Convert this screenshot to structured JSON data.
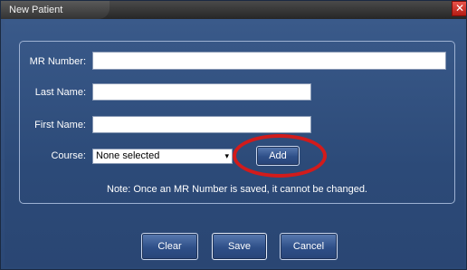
{
  "window": {
    "title": "New Patient",
    "close_symbol": "✕"
  },
  "form": {
    "mr_number": {
      "label": "MR Number:",
      "value": ""
    },
    "last_name": {
      "label": "Last Name:",
      "value": ""
    },
    "first_name": {
      "label": "First Name:",
      "value": ""
    },
    "course": {
      "label": "Course:",
      "selected": "None selected"
    },
    "add_label": "Add",
    "note": "Note: Once an MR Number is saved, it cannot be changed."
  },
  "buttons": {
    "clear": "Clear",
    "save": "Save",
    "cancel": "Cancel"
  },
  "colors": {
    "annotation_circle": "#d21b1b"
  }
}
